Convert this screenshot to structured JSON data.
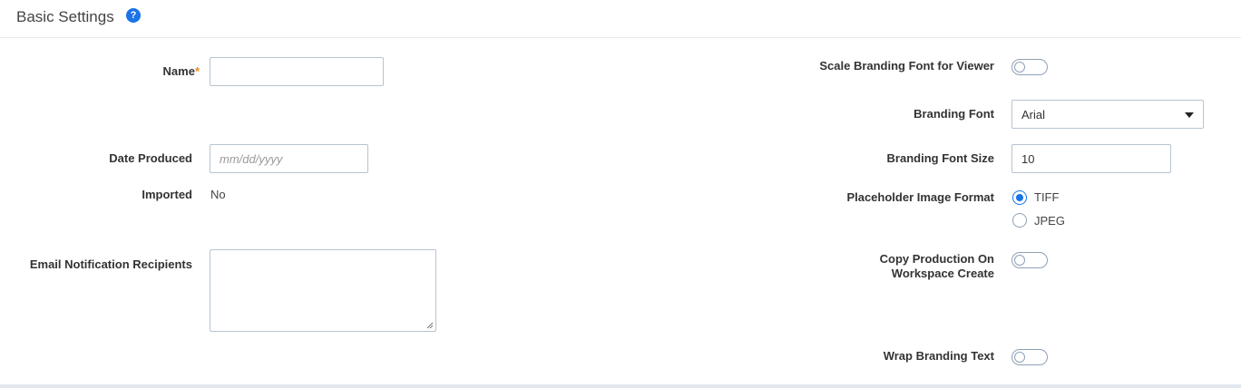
{
  "header": {
    "title": "Basic Settings",
    "help_icon": "?"
  },
  "left": {
    "name": {
      "label": "Name",
      "required_mark": "*",
      "value": ""
    },
    "date_produced": {
      "label": "Date Produced",
      "placeholder": "mm/dd/yyyy",
      "value": ""
    },
    "imported": {
      "label": "Imported",
      "value": "No"
    },
    "email_recipients": {
      "label": "Email Notification Recipients",
      "value": ""
    }
  },
  "right": {
    "scale_branding": {
      "label": "Scale Branding Font for Viewer",
      "enabled": false
    },
    "branding_font": {
      "label": "Branding Font",
      "selected": "Arial"
    },
    "branding_font_size": {
      "label": "Branding Font Size",
      "value": "10"
    },
    "placeholder_format": {
      "label": "Placeholder Image Format",
      "options": [
        "TIFF",
        "JPEG"
      ],
      "selected": "TIFF"
    },
    "copy_production": {
      "label_line1": "Copy Production On",
      "label_line2": "Workspace Create",
      "enabled": false
    },
    "wrap_branding": {
      "label": "Wrap Branding Text",
      "enabled": false
    }
  },
  "colors": {
    "accent": "#1a73e8",
    "required": "#f28b1e",
    "border": "#b8c3d1"
  }
}
